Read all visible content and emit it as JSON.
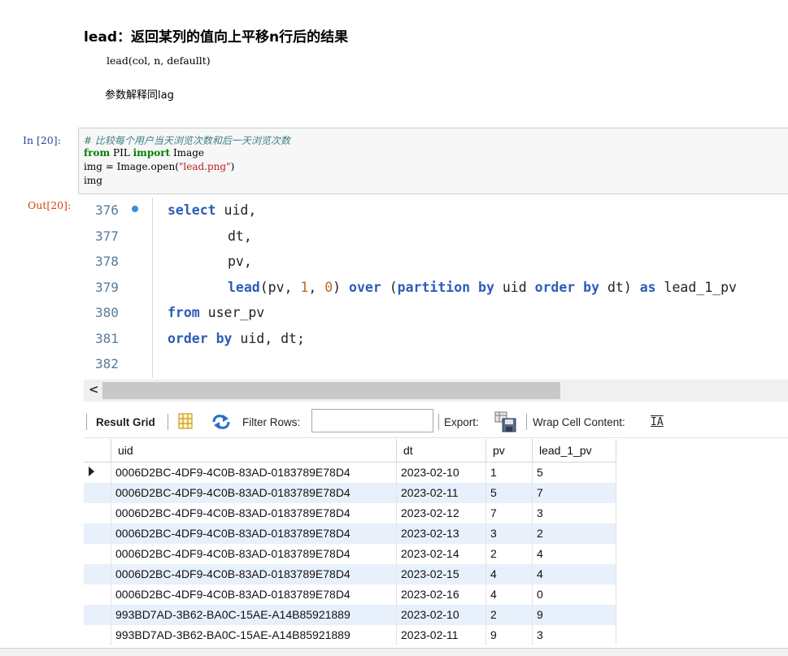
{
  "markdown": {
    "title": "lead：返回某列的值向上平移n行后的结果",
    "code": "lead(col, n, defaullt)",
    "para": "参数解释同lag"
  },
  "input_cell": {
    "prompt": "In  [20]:",
    "lines": {
      "comment": "# 比较每个用户当天浏览次数和后一天浏览次数",
      "l2_kw1": "from",
      "l2_mid": " PIL ",
      "l2_kw2": "import",
      "l2_end": " Image",
      "l3_pre": "img = Image.open(",
      "l3_str": "\"lead.png\"",
      "l3_end": ")",
      "l4": "img"
    }
  },
  "output_cell": {
    "prompt": "Out[20]:"
  },
  "editor": {
    "line_numbers": [
      "376",
      "377",
      "378",
      "379",
      "380",
      "381",
      "382"
    ],
    "sql": {
      "l1_kw": "select",
      "l1_rest": " uid,",
      "l2": "dt,",
      "l3": "pv,",
      "l4_fn": "lead",
      "l4_a": "(pv, ",
      "l4_n1": "1",
      "l4_b": ", ",
      "l4_n2": "0",
      "l4_c": ") ",
      "l4_kw1": "over",
      "l4_d": " (",
      "l4_kw2": "partition by",
      "l4_e": " uid ",
      "l4_kw3": "order by",
      "l4_f": " dt) ",
      "l4_kw4": "as",
      "l4_g": " lead_1_pv",
      "l5_kw": "from",
      "l5_rest": " user_pv",
      "l6_kw": "order by",
      "l6_rest": " uid, dt;"
    }
  },
  "toolbar": {
    "result_grid": "Result Grid",
    "filter_rows": "Filter Rows:",
    "export": "Export:",
    "wrap_cell": "Wrap Cell Content:",
    "wrap_glyph": "IA"
  },
  "grid": {
    "columns": [
      "uid",
      "dt",
      "pv",
      "lead_1_pv"
    ],
    "rows": [
      [
        "0006D2BC-4DF9-4C0B-83AD-0183789E78D4",
        "2023-02-10",
        "1",
        "5"
      ],
      [
        "0006D2BC-4DF9-4C0B-83AD-0183789E78D4",
        "2023-02-11",
        "5",
        "7"
      ],
      [
        "0006D2BC-4DF9-4C0B-83AD-0183789E78D4",
        "2023-02-12",
        "7",
        "3"
      ],
      [
        "0006D2BC-4DF9-4C0B-83AD-0183789E78D4",
        "2023-02-13",
        "3",
        "2"
      ],
      [
        "0006D2BC-4DF9-4C0B-83AD-0183789E78D4",
        "2023-02-14",
        "2",
        "4"
      ],
      [
        "0006D2BC-4DF9-4C0B-83AD-0183789E78D4",
        "2023-02-15",
        "4",
        "4"
      ],
      [
        "0006D2BC-4DF9-4C0B-83AD-0183789E78D4",
        "2023-02-16",
        "4",
        "0"
      ],
      [
        "993BD7AD-3B62-BA0C-15AE-A14B85921889",
        "2023-02-10",
        "2",
        "9"
      ],
      [
        "993BD7AD-3B62-BA0C-15AE-A14B85921889",
        "2023-02-11",
        "9",
        "3"
      ]
    ]
  },
  "colors": {
    "in_prompt": "#303f9f",
    "out_prompt": "#d84315",
    "sql_keyword": "#2b5db8",
    "alt_row": "#e8f0fb"
  }
}
